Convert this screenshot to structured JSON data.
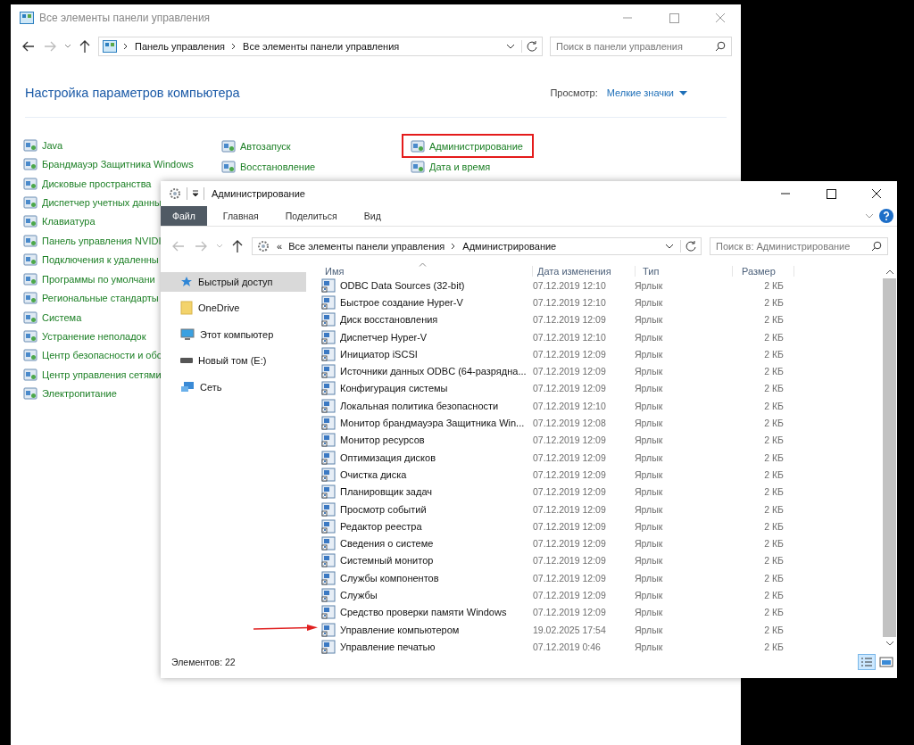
{
  "back_window": {
    "title": "Все элементы панели управления",
    "breadcrumb": [
      "Панель управления",
      "Все элементы панели управления"
    ],
    "search": {
      "placeholder": "Поиск в панели управления"
    },
    "heading": "Настройка параметров компьютера",
    "view_label": "Просмотр:",
    "view_value": "Мелкие значки",
    "columns": [
      [
        {
          "label": "Java",
          "highlighted": false
        },
        {
          "label": "Брандмауэр Защитника Windows",
          "highlighted": false
        },
        {
          "label": "Дисковые пространства",
          "highlighted": false
        },
        {
          "label": "Диспетчер учетных данны",
          "highlighted": false
        },
        {
          "label": "Клавиатура",
          "highlighted": false
        },
        {
          "label": "Панель управления NVIDI",
          "highlighted": false
        },
        {
          "label": "Подключения к удаленны",
          "highlighted": false
        },
        {
          "label": "Программы по умолчани",
          "highlighted": false
        },
        {
          "label": "Региональные стандарты",
          "highlighted": false
        },
        {
          "label": "Система",
          "highlighted": false
        },
        {
          "label": "Устранение неполадок",
          "highlighted": false
        },
        {
          "label": "Центр безопасности и обс",
          "highlighted": false
        },
        {
          "label": "Центр управления сетями",
          "highlighted": false
        },
        {
          "label": "Электропитание",
          "highlighted": false
        }
      ],
      [
        {
          "label": "Автозапуск",
          "highlighted": false
        },
        {
          "label": "Восстановление",
          "highlighted": false
        }
      ],
      [
        {
          "label": "Администрирование",
          "highlighted": true
        },
        {
          "label": "Дата и время",
          "highlighted": false
        }
      ]
    ]
  },
  "front_window": {
    "title": "Администрирование",
    "ribbon_tabs": [
      {
        "label": "Файл",
        "selected": true
      },
      {
        "label": "Главная",
        "selected": false
      },
      {
        "label": "Поделиться",
        "selected": false
      },
      {
        "label": "Вид",
        "selected": false
      }
    ],
    "breadcrumb_prefix": "«",
    "breadcrumb": [
      "Все элементы панели управления",
      "Администрирование"
    ],
    "search": {
      "placeholder": "Поиск в: Администрирование"
    },
    "nav": [
      {
        "label": "Быстрый доступ",
        "kind": "star",
        "selected": true
      },
      {
        "label": "OneDrive",
        "kind": "folder",
        "selected": false
      },
      {
        "label": "Этот компьютер",
        "kind": "computer",
        "selected": false
      },
      {
        "label": "Новый том (E:)",
        "kind": "drive",
        "selected": false
      },
      {
        "label": "Сеть",
        "kind": "network",
        "selected": false
      }
    ],
    "columns": [
      "Имя",
      "Дата изменения",
      "Тип",
      "Размер"
    ],
    "rows": [
      {
        "name": "ODBC Data Sources (32-bit)",
        "date": "07.12.2019 12:10",
        "type": "Ярлык",
        "size": "2 КБ",
        "pointed": false
      },
      {
        "name": "Быстрое создание Hyper-V",
        "date": "07.12.2019 12:10",
        "type": "Ярлык",
        "size": "2 КБ",
        "pointed": false
      },
      {
        "name": "Диск восстановления",
        "date": "07.12.2019 12:09",
        "type": "Ярлык",
        "size": "2 КБ",
        "pointed": false
      },
      {
        "name": "Диспетчер Hyper-V",
        "date": "07.12.2019 12:10",
        "type": "Ярлык",
        "size": "2 КБ",
        "pointed": false
      },
      {
        "name": "Инициатор iSCSI",
        "date": "07.12.2019 12:09",
        "type": "Ярлык",
        "size": "2 КБ",
        "pointed": false
      },
      {
        "name": "Источники данных ODBC (64-разрядна...",
        "date": "07.12.2019 12:09",
        "type": "Ярлык",
        "size": "2 КБ",
        "pointed": false
      },
      {
        "name": "Конфигурация системы",
        "date": "07.12.2019 12:09",
        "type": "Ярлык",
        "size": "2 КБ",
        "pointed": false
      },
      {
        "name": "Локальная политика безопасности",
        "date": "07.12.2019 12:10",
        "type": "Ярлык",
        "size": "2 КБ",
        "pointed": false
      },
      {
        "name": "Монитор брандмауэра Защитника Win...",
        "date": "07.12.2019 12:08",
        "type": "Ярлык",
        "size": "2 КБ",
        "pointed": false
      },
      {
        "name": "Монитор ресурсов",
        "date": "07.12.2019 12:09",
        "type": "Ярлык",
        "size": "2 КБ",
        "pointed": false
      },
      {
        "name": "Оптимизация дисков",
        "date": "07.12.2019 12:09",
        "type": "Ярлык",
        "size": "2 КБ",
        "pointed": false
      },
      {
        "name": "Очистка диска",
        "date": "07.12.2019 12:09",
        "type": "Ярлык",
        "size": "2 КБ",
        "pointed": false
      },
      {
        "name": "Планировщик задач",
        "date": "07.12.2019 12:09",
        "type": "Ярлык",
        "size": "2 КБ",
        "pointed": false
      },
      {
        "name": "Просмотр событий",
        "date": "07.12.2019 12:09",
        "type": "Ярлык",
        "size": "2 КБ",
        "pointed": false
      },
      {
        "name": "Редактор реестра",
        "date": "07.12.2019 12:09",
        "type": "Ярлык",
        "size": "2 КБ",
        "pointed": false
      },
      {
        "name": "Сведения о системе",
        "date": "07.12.2019 12:09",
        "type": "Ярлык",
        "size": "2 КБ",
        "pointed": false
      },
      {
        "name": "Системный монитор",
        "date": "07.12.2019 12:09",
        "type": "Ярлык",
        "size": "2 КБ",
        "pointed": false
      },
      {
        "name": "Службы компонентов",
        "date": "07.12.2019 12:09",
        "type": "Ярлык",
        "size": "2 КБ",
        "pointed": false
      },
      {
        "name": "Службы",
        "date": "07.12.2019 12:09",
        "type": "Ярлык",
        "size": "2 КБ",
        "pointed": false
      },
      {
        "name": "Средство проверки памяти Windows",
        "date": "07.12.2019 12:09",
        "type": "Ярлык",
        "size": "2 КБ",
        "pointed": false
      },
      {
        "name": "Управление компьютером",
        "date": "19.02.2025 17:54",
        "type": "Ярлык",
        "size": "2 КБ",
        "pointed": true
      },
      {
        "name": "Управление печатью",
        "date": "07.12.2019 0:46",
        "type": "Ярлык",
        "size": "2 КБ",
        "pointed": false
      }
    ],
    "status": "Элементов: 22"
  }
}
